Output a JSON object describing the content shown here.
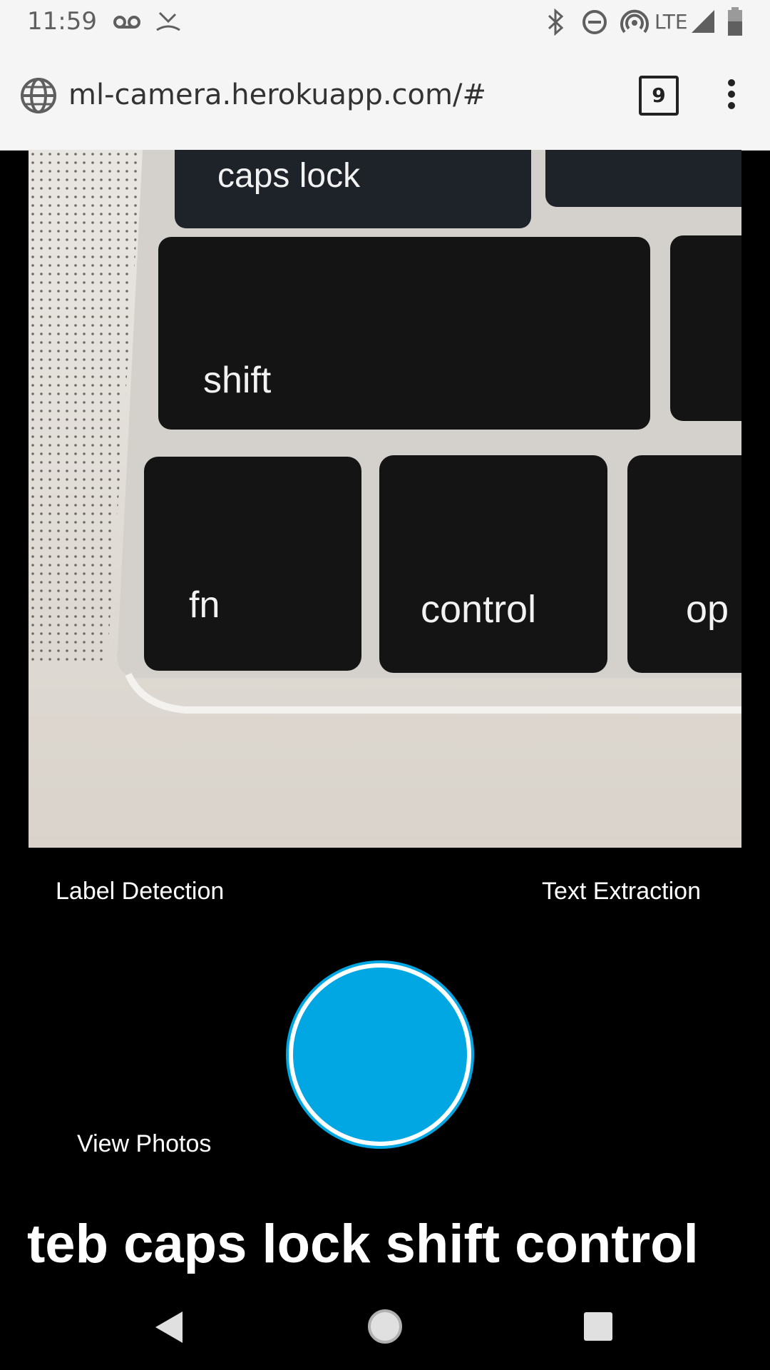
{
  "status_bar": {
    "time": "11:59",
    "network": "LTE",
    "icons": [
      "voicemail-icon",
      "missed-call-icon",
      "bluetooth-icon",
      "do-not-disturb-icon",
      "hotspot-icon",
      "signal-icon",
      "battery-icon"
    ]
  },
  "browser": {
    "url": "ml-camera.herokuapp.com/#",
    "tab_count": "9",
    "icons": [
      "globe-icon",
      "more-vert-icon"
    ]
  },
  "camera": {
    "key_labels": [
      "caps lock",
      "shift",
      "fn",
      "control",
      "op"
    ]
  },
  "modes": {
    "left": "Label Detection",
    "right": "Text Extraction"
  },
  "actions": {
    "view_photos": "View Photos"
  },
  "result": {
    "text": "teb caps lock shift control"
  },
  "colors": {
    "accent": "#00a7e3",
    "background": "#000000",
    "bar": "#f5f5f5"
  },
  "nav_bar": {
    "icons": [
      "back-icon",
      "home-icon",
      "recents-icon"
    ]
  }
}
